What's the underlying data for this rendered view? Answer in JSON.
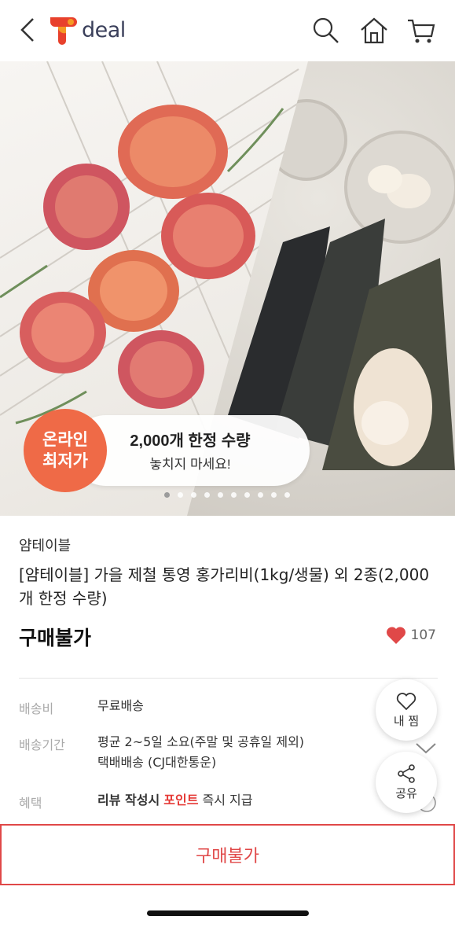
{
  "header": {
    "logo_text": "deal",
    "icons": [
      "back-icon",
      "search-icon",
      "home-icon",
      "cart-icon"
    ],
    "brand_color": "#e8412c"
  },
  "hero": {
    "promo_badge": [
      "온라인",
      "최저가"
    ],
    "promo_line1": "2,000개 한정 수량",
    "promo_line2": "놓치지 마세요!",
    "slide_count": 10,
    "active_slide": 1
  },
  "product": {
    "brand": "얌테이블",
    "title": "[얌테이블] 가을 제철 통영 홍가리비(1kg/생물) 외 2종(2,000개 한정 수량)",
    "status": "구매불가",
    "like_count": "107",
    "like_color": "#e04848"
  },
  "info": {
    "shipping_fee_label": "배송비",
    "shipping_fee_value": "무료배송",
    "delivery_label": "배송기간",
    "delivery_value1": "평균 2~5일 소요(주말 및 공휴일 제외)",
    "delivery_value2": "택배배송 (CJ대한통운)",
    "benefit_label": "혜택",
    "benefit_prefix": "리뷰 작성시",
    "benefit_point": "포인트",
    "benefit_suffix": "즉시 지급"
  },
  "floating": {
    "wishlist_label": "내 찜",
    "share_label": "공유"
  },
  "bottom": {
    "buy_label": "구매불가"
  }
}
